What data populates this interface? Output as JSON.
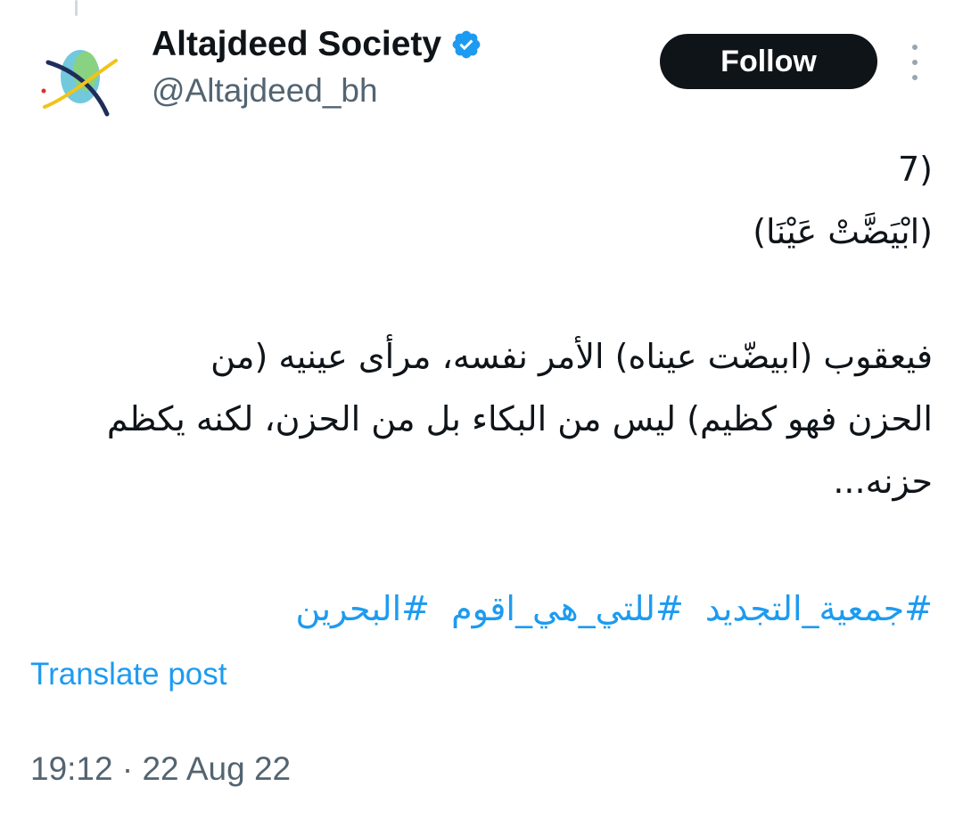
{
  "author": {
    "display_name": "Altajdeed Society",
    "handle": "@Altajdeed_bh",
    "verified": true,
    "avatar_icon": "altajdeed-logo-icon",
    "verified_icon": "verified-badge-icon"
  },
  "actions": {
    "follow_label": "Follow",
    "more_icon": "more-vertical-icon"
  },
  "tweet": {
    "lines": [
      "(7",
      "(ابْيَضَّتْ عَيْنَا)",
      "",
      "فيعقوب (ابيضّت عيناه) الأمر نفسه، مرأى عينيه (من",
      "الحزن فهو كظيم) ليس من البكاء بل من الحزن، لكنه يكظم",
      "حزنه..."
    ],
    "hashtags": [
      "#جمعية_التجديد",
      "#للتي_هي_اقوم",
      "#البحرين"
    ]
  },
  "translate_label": "Translate post",
  "timestamp": "19:12 · 22 Aug 22",
  "colors": {
    "link": "#1d9bf0",
    "text_primary": "#0f1419",
    "text_secondary": "#536471",
    "button_bg": "#0f1419"
  }
}
